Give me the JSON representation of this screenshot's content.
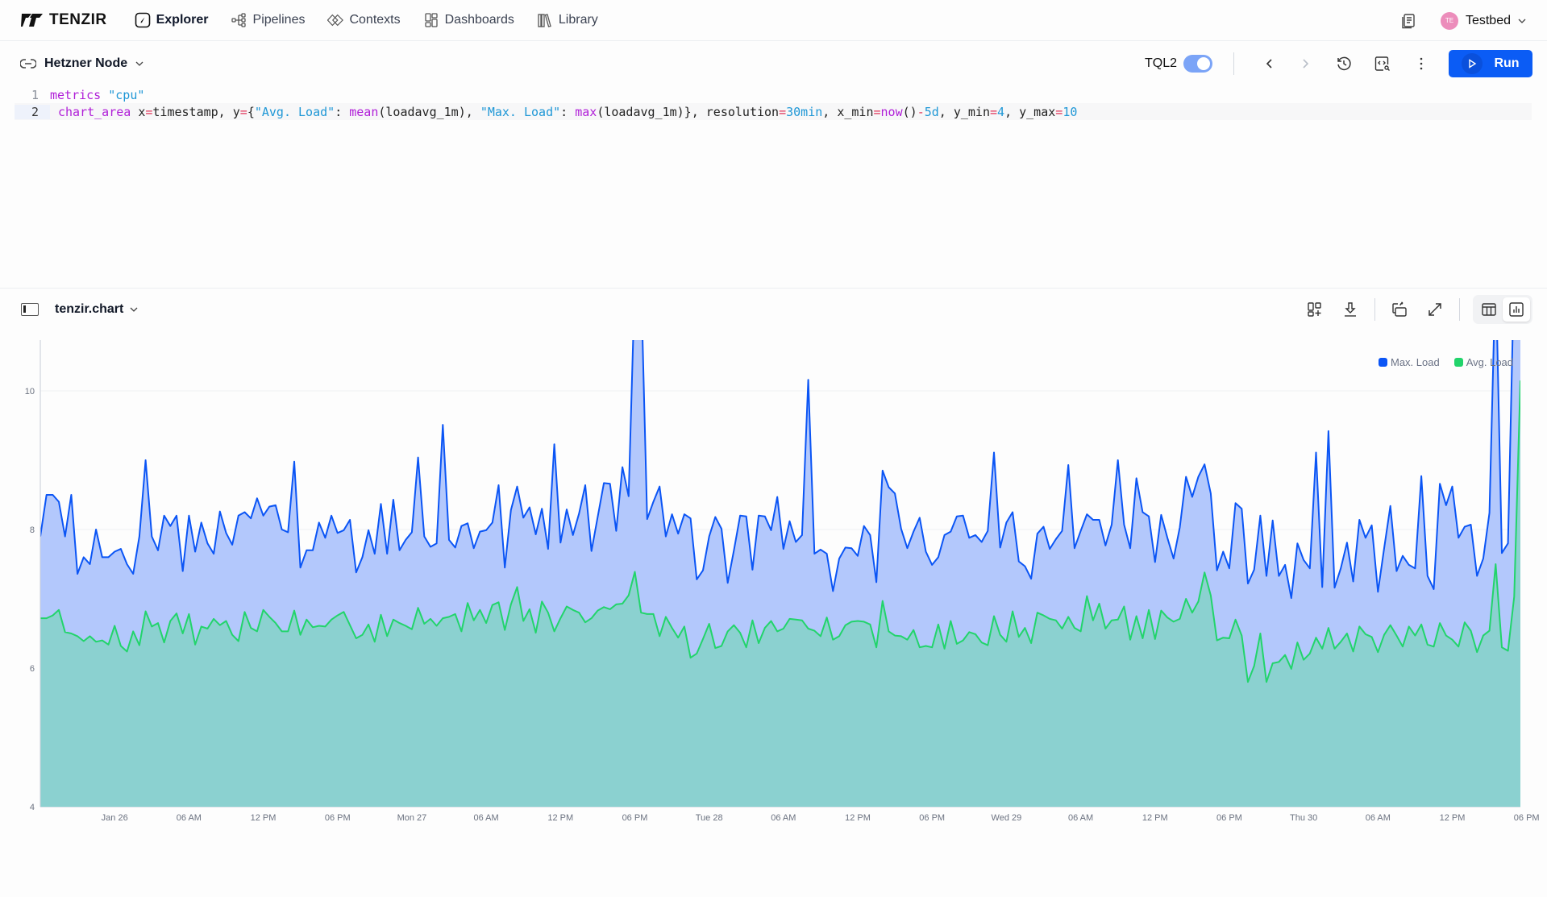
{
  "app": {
    "brand": "TENZIR",
    "nav": [
      {
        "label": "Explorer",
        "icon": "compass-icon",
        "active": true
      },
      {
        "label": "Pipelines",
        "icon": "pipeline-icon",
        "active": false
      },
      {
        "label": "Contexts",
        "icon": "contexts-icon",
        "active": false
      },
      {
        "label": "Dashboards",
        "icon": "dashboard-icon",
        "active": false
      },
      {
        "label": "Library",
        "icon": "library-icon",
        "active": false
      }
    ],
    "user": {
      "initials": "TE",
      "name": "Testbed",
      "avatar_color": "#ec8dbb"
    }
  },
  "editor": {
    "node": "Hetzner Node",
    "language_label": "TQL2",
    "language_toggle_on": true,
    "run_label": "Run",
    "accent": "#0b5cf5",
    "lines": [
      {
        "num": "1",
        "tokens": [
          {
            "t": "kw",
            "v": "metrics"
          },
          {
            "t": "plain",
            "v": " "
          },
          {
            "t": "str",
            "v": "\"cpu\""
          }
        ]
      },
      {
        "num": "2",
        "tokens": [
          {
            "t": "kw",
            "v": "chart_area"
          },
          {
            "t": "plain",
            "v": " x"
          },
          {
            "t": "op",
            "v": "="
          },
          {
            "t": "plain",
            "v": "timestamp, y"
          },
          {
            "t": "op",
            "v": "="
          },
          {
            "t": "plain",
            "v": "{"
          },
          {
            "t": "str",
            "v": "\"Avg. Load\""
          },
          {
            "t": "plain",
            "v": ": "
          },
          {
            "t": "kw",
            "v": "mean"
          },
          {
            "t": "plain",
            "v": "(loadavg_1m), "
          },
          {
            "t": "str",
            "v": "\"Max. Load\""
          },
          {
            "t": "plain",
            "v": ": "
          },
          {
            "t": "kw",
            "v": "max"
          },
          {
            "t": "plain",
            "v": "(loadavg_1m)}, resolution"
          },
          {
            "t": "op",
            "v": "="
          },
          {
            "t": "num",
            "v": "30min"
          },
          {
            "t": "plain",
            "v": ", x_min"
          },
          {
            "t": "op",
            "v": "="
          },
          {
            "t": "kw",
            "v": "now"
          },
          {
            "t": "plain",
            "v": "()"
          },
          {
            "t": "op",
            "v": "-"
          },
          {
            "t": "num",
            "v": "5d"
          },
          {
            "t": "plain",
            "v": ", y_min"
          },
          {
            "t": "op",
            "v": "="
          },
          {
            "t": "num",
            "v": "4"
          },
          {
            "t": "plain",
            "v": ", y_max"
          },
          {
            "t": "op",
            "v": "="
          },
          {
            "t": "num",
            "v": "10"
          }
        ]
      }
    ]
  },
  "results": {
    "name": "tenzir.chart",
    "view_modes": [
      {
        "label": "table",
        "selected": false
      },
      {
        "label": "chart",
        "selected": true
      }
    ]
  },
  "chart_data": {
    "type": "area",
    "title": "",
    "xlabel": "",
    "ylabel": "",
    "ylim": [
      4,
      10
    ],
    "yticks": [
      4,
      6,
      8,
      10
    ],
    "grid": true,
    "legend_position": "top-right",
    "x_start": "Jan 25 18:00",
    "x_step_minutes": 30,
    "xtick_labels": [
      "Jan 26",
      "06 AM",
      "12 PM",
      "06 PM",
      "Mon 27",
      "06 AM",
      "12 PM",
      "06 PM",
      "Tue 28",
      "06 AM",
      "12 PM",
      "06 PM",
      "Wed 29",
      "06 AM",
      "12 PM",
      "06 PM",
      "Thu 30",
      "06 AM",
      "12 PM",
      "06 PM"
    ],
    "xtick_offsets_hours": [
      6,
      12,
      18,
      24,
      30,
      36,
      42,
      48,
      54,
      60,
      66,
      72,
      78,
      84,
      90,
      96,
      102,
      108,
      114,
      120
    ],
    "series": [
      {
        "name": "Max. Load",
        "color": "#0b55f5",
        "fill": "#b3c8fc",
        "values": [
          7.9,
          8.5,
          8.5,
          8.4,
          7.9,
          8.5,
          7.36,
          7.6,
          7.5,
          8.0,
          7.6,
          7.6,
          7.68,
          7.72,
          7.5,
          7.36,
          7.9,
          9.0,
          7.9,
          7.7,
          8.2,
          8.05,
          8.2,
          7.4,
          8.2,
          7.68,
          8.1,
          7.8,
          7.65,
          8.26,
          7.95,
          7.78,
          8.2,
          8.25,
          8.16,
          8.45,
          8.2,
          8.33,
          8.35,
          8.0,
          7.96,
          8.98,
          7.45,
          7.7,
          7.7,
          8.1,
          7.88,
          8.2,
          7.95,
          7.99,
          8.14,
          7.38,
          7.6,
          7.99,
          7.65,
          8.37,
          7.65,
          8.43,
          7.7,
          7.85,
          7.96,
          9.04,
          7.9,
          7.75,
          7.8,
          9.51,
          7.85,
          7.74,
          8.05,
          8.09,
          7.73,
          7.97,
          7.99,
          8.1,
          8.64,
          7.45,
          8.28,
          8.62,
          8.17,
          8.32,
          7.93,
          8.3,
          7.72,
          9.23,
          7.81,
          8.29,
          7.92,
          8.23,
          8.64,
          7.69,
          8.18,
          8.67,
          8.66,
          7.98,
          8.9,
          8.48,
          11.6,
          11.6,
          8.15,
          8.4,
          8.62,
          7.9,
          8.22,
          7.94,
          8.22,
          8.16,
          7.28,
          7.41,
          7.9,
          8.18,
          8.01,
          7.23,
          7.7,
          8.2,
          8.19,
          7.42,
          8.2,
          8.19,
          7.99,
          8.47,
          7.72,
          8.12,
          7.82,
          7.92,
          10.16,
          7.65,
          7.71,
          7.65,
          7.11,
          7.58,
          7.74,
          7.73,
          7.62,
          8.05,
          7.92,
          7.24,
          8.85,
          8.61,
          8.52,
          8.01,
          7.73,
          7.97,
          8.17,
          7.68,
          7.49,
          7.6,
          7.92,
          7.97,
          8.19,
          8.2,
          7.88,
          7.92,
          7.82,
          7.98,
          9.11,
          7.74,
          8.1,
          8.25,
          7.54,
          7.47,
          7.29,
          7.94,
          8.04,
          7.72,
          7.86,
          7.98,
          8.93,
          7.73,
          7.98,
          8.22,
          8.14,
          8.14,
          7.77,
          8.07,
          9.0,
          8.07,
          7.73,
          8.74,
          8.25,
          8.19,
          7.53,
          8.21,
          7.88,
          7.58,
          8.03,
          8.76,
          8.47,
          8.76,
          8.94,
          8.52,
          7.41,
          7.68,
          7.44,
          8.38,
          8.3,
          7.22,
          7.42,
          8.2,
          7.33,
          8.13,
          7.33,
          7.49,
          7.01,
          7.8,
          7.56,
          7.44,
          9.11,
          7.17,
          9.42,
          7.16,
          7.44,
          7.81,
          7.25,
          8.14,
          7.88,
          8.06,
          7.1,
          7.73,
          8.34,
          7.4,
          7.62,
          7.49,
          7.44,
          8.77,
          7.33,
          7.14,
          8.66,
          8.35,
          8.62,
          7.88,
          8.04,
          8.07,
          7.33,
          7.58,
          8.24,
          11.8,
          7.66,
          7.8,
          11.8,
          11.8
        ]
      },
      {
        "name": "Avg. Load",
        "color": "#22d46b",
        "fill": "#8bd1d0",
        "values": [
          6.72,
          6.72,
          6.76,
          6.84,
          6.52,
          6.5,
          6.46,
          6.39,
          6.46,
          6.38,
          6.4,
          6.34,
          6.61,
          6.32,
          6.24,
          6.53,
          6.33,
          6.82,
          6.6,
          6.65,
          6.37,
          6.68,
          6.79,
          6.5,
          6.78,
          6.34,
          6.6,
          6.57,
          6.71,
          6.62,
          6.68,
          6.48,
          6.39,
          6.81,
          6.58,
          6.53,
          6.84,
          6.74,
          6.65,
          6.53,
          6.53,
          6.83,
          6.48,
          6.7,
          6.59,
          6.61,
          6.6,
          6.7,
          6.76,
          6.81,
          6.62,
          6.43,
          6.48,
          6.63,
          6.38,
          6.77,
          6.46,
          6.7,
          6.65,
          6.61,
          6.56,
          6.87,
          6.64,
          6.71,
          6.61,
          6.72,
          6.74,
          6.78,
          6.53,
          6.94,
          6.69,
          6.84,
          6.65,
          6.91,
          6.95,
          6.55,
          6.92,
          7.17,
          6.68,
          6.85,
          6.51,
          6.96,
          6.8,
          6.53,
          6.72,
          6.89,
          6.84,
          6.8,
          6.66,
          6.72,
          6.83,
          6.88,
          6.85,
          6.92,
          6.93,
          7.05,
          7.39,
          6.8,
          6.78,
          6.78,
          6.46,
          6.74,
          6.58,
          6.44,
          6.6,
          6.15,
          6.21,
          6.42,
          6.64,
          6.29,
          6.32,
          6.53,
          6.62,
          6.51,
          6.3,
          6.69,
          6.36,
          6.58,
          6.68,
          6.53,
          6.57,
          6.71,
          6.7,
          6.69,
          6.57,
          6.54,
          6.46,
          6.73,
          6.41,
          6.46,
          6.62,
          6.67,
          6.68,
          6.67,
          6.63,
          6.3,
          6.97,
          6.53,
          6.47,
          6.46,
          6.41,
          6.55,
          6.3,
          6.32,
          6.3,
          6.63,
          6.28,
          6.68,
          6.35,
          6.4,
          6.52,
          6.49,
          6.37,
          6.33,
          6.75,
          6.48,
          6.38,
          6.82,
          6.45,
          6.58,
          6.36,
          6.8,
          6.76,
          6.71,
          6.69,
          6.57,
          6.74,
          6.58,
          6.53,
          7.04,
          6.69,
          6.93,
          6.57,
          6.69,
          6.7,
          6.89,
          6.41,
          6.75,
          6.43,
          6.84,
          6.42,
          6.83,
          6.73,
          6.67,
          6.71,
          7.0,
          6.8,
          6.96,
          7.38,
          7.05,
          6.4,
          6.44,
          6.43,
          6.7,
          6.47,
          5.8,
          6.03,
          6.5,
          5.8,
          6.07,
          6.09,
          6.19,
          5.99,
          6.37,
          6.12,
          6.21,
          6.44,
          6.28,
          6.58,
          6.28,
          6.38,
          6.5,
          6.24,
          6.6,
          6.49,
          6.45,
          6.23,
          6.48,
          6.62,
          6.47,
          6.31,
          6.6,
          6.47,
          6.63,
          6.34,
          6.31,
          6.65,
          6.47,
          6.41,
          6.31,
          6.66,
          6.54,
          6.23,
          6.47,
          6.54,
          7.5,
          6.3,
          6.25,
          7.03,
          10.15
        ]
      }
    ]
  }
}
